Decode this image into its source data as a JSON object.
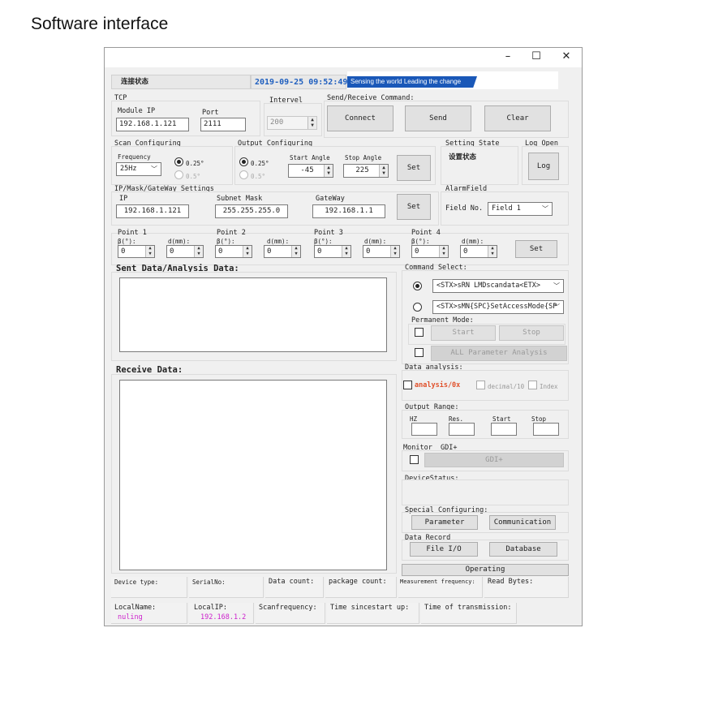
{
  "page": {
    "heading": "Software interface"
  },
  "window": {
    "title_buttons": {
      "minimize": "–",
      "maximize": "☐",
      "close": "✕"
    },
    "status_bar": {
      "connection_status": "连接状态",
      "datetime": "2019-09-25 09:52:49",
      "banner": "Sensing the world  Leading the change"
    }
  },
  "tcp": {
    "label": "TCP",
    "module_ip_label": "Module IP",
    "module_ip": "192.168.1.121",
    "port_label": "Port",
    "port": "2111"
  },
  "interval": {
    "label": "Intervel",
    "value": "200"
  },
  "send_receive": {
    "label": "Send/Receive Command:",
    "connect": "Connect",
    "send": "Send",
    "clear": "Clear"
  },
  "scan": {
    "label": "Scan Configuring",
    "frequency_label": "Frequency",
    "frequency": "25Hz",
    "res1": "0.25°",
    "res2": "0.5°"
  },
  "output_cfg": {
    "label": "Output Configuring",
    "res1": "0.25°",
    "res2": "0.5°",
    "start_label": "Start Angle",
    "start": "-45",
    "stop_label": "Stop Angle",
    "stop": "225",
    "set": "Set"
  },
  "setting_state": {
    "label": "Setting State",
    "value": "设置状态"
  },
  "log_open": {
    "label": "Log Open",
    "button": "Log"
  },
  "ip_settings": {
    "label": "IP/Mask/GateWay Settings",
    "ip_label": "IP",
    "ip": "192.168.1.121",
    "mask_label": "Subnet Mask",
    "mask": "255.255.255.0",
    "gateway_label": "GateWay",
    "gateway": "192.168.1.1",
    "set": "Set"
  },
  "alarm": {
    "label": "AlarmField",
    "field_no_label": "Field No.",
    "field_no": "Field 1"
  },
  "points": {
    "items": [
      {
        "label": "Point 1",
        "beta_label": "β(°):",
        "beta": "0",
        "d_label": "d(mm):",
        "d": "0"
      },
      {
        "label": "Point 2",
        "beta_label": "β(°):",
        "beta": "0",
        "d_label": "d(mm):",
        "d": "0"
      },
      {
        "label": "Point 3",
        "beta_label": "β(°):",
        "beta": "0",
        "d_label": "d(mm):",
        "d": "0"
      },
      {
        "label": "Point 4",
        "beta_label": "β(°):",
        "beta": "0",
        "d_label": "d(mm):",
        "d": "0"
      }
    ],
    "set": "Set"
  },
  "sent_data": {
    "label": "Sent Data/Analysis Data:"
  },
  "receive_data": {
    "label": "Receive Data:"
  },
  "command_select": {
    "label": "Command Select:",
    "option1": "<STX>sRN LMDscandata<ETX>",
    "option2": "<STX>sMN{SPC}SetAccessMode{SP",
    "permanent_label": "Permanent Mode:",
    "start": "Start",
    "stop": "Stop",
    "all_param": "ALL Parameter Analysis"
  },
  "data_analysis": {
    "label": "Data analysis:",
    "hex": "analysis/0x",
    "decimal": "decimal/10",
    "index": "Index"
  },
  "output_range": {
    "label": "Output Range:",
    "hz": "HZ",
    "res": "Res.",
    "start": "Start",
    "stop": "Stop"
  },
  "monitor": {
    "label": "Monitor _GDI+",
    "button": "GDI+"
  },
  "device_status": {
    "label": "DeviceStatus:"
  },
  "special": {
    "label": "Special Configuring:",
    "parameter": "Parameter",
    "communication": "Communication"
  },
  "data_record": {
    "label": "Data Record",
    "file_io": "File I/O",
    "database": "Database"
  },
  "operating": {
    "label": "Operating"
  },
  "status_row1": {
    "device_type": "Device type:",
    "serial_no": "SerialNo:",
    "data_count": "Data count:",
    "package_count": "package count:",
    "measurement_frequency": "Measurement frequency:",
    "read_bytes": "Read Bytes:"
  },
  "status_row2": {
    "local_name_label": "LocalName:",
    "local_name": "nuling",
    "local_ip_label": "LocalIP:",
    "local_ip": "192.168.1.2",
    "scan_frequency": "Scanfrequency:",
    "time_since_start": "Time sincestart up:",
    "time_of_transmission": "Time of transmission:"
  },
  "colors": {
    "accent_blue": "#1f5fbf",
    "banner_blue": "#1a58b8",
    "magenta": "#cc22cc",
    "orange_red": "#e0502a"
  }
}
